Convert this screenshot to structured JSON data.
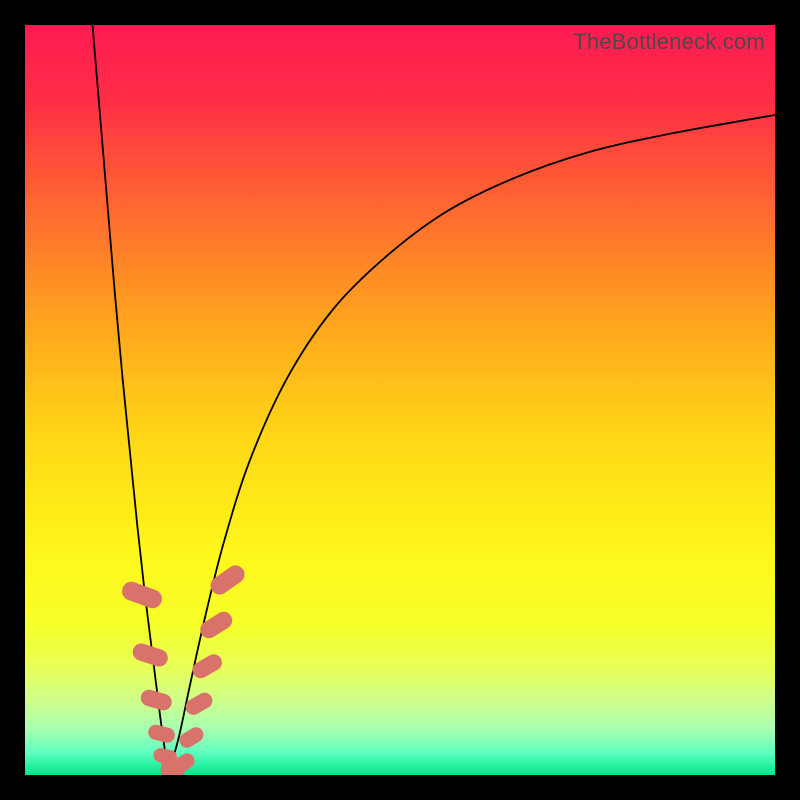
{
  "watermark": "TheBottleneck.com",
  "colors": {
    "frame": "#000000",
    "gradient_stops": [
      {
        "offset": 0.0,
        "color": "#ff1a52"
      },
      {
        "offset": 0.1,
        "color": "#ff2e46"
      },
      {
        "offset": 0.25,
        "color": "#ff6b2f"
      },
      {
        "offset": 0.4,
        "color": "#ffa61d"
      },
      {
        "offset": 0.55,
        "color": "#ffd716"
      },
      {
        "offset": 0.7,
        "color": "#fff61a"
      },
      {
        "offset": 0.8,
        "color": "#f6ff2a"
      },
      {
        "offset": 0.86,
        "color": "#e6ff5a"
      },
      {
        "offset": 0.9,
        "color": "#cfff8a"
      },
      {
        "offset": 0.94,
        "color": "#a6ffb0"
      },
      {
        "offset": 0.97,
        "color": "#5effc0"
      },
      {
        "offset": 1.0,
        "color": "#00e88a"
      }
    ],
    "curve": "#000000",
    "beads": "#d9726a"
  },
  "chart_data": {
    "type": "line",
    "title": "",
    "xlabel": "",
    "ylabel": "",
    "xlim": [
      0,
      100
    ],
    "ylim": [
      0,
      100
    ],
    "note": "Two monotone branches forming a cusp near x≈19, y=0. Values read from pixel positions; y=100 at top, y=0 at bottom.",
    "series": [
      {
        "name": "left-branch",
        "x": [
          9.0,
          10.0,
          11.0,
          12.0,
          13.0,
          14.0,
          15.0,
          16.0,
          17.0,
          18.0,
          18.7,
          19.2
        ],
        "y": [
          100,
          88,
          76,
          64,
          53,
          43,
          33,
          24,
          16,
          8,
          3,
          0.5
        ]
      },
      {
        "name": "right-branch",
        "x": [
          19.2,
          20.5,
          22.0,
          24.0,
          26.5,
          30.0,
          35.0,
          41.0,
          48.0,
          56.0,
          65.0,
          75.0,
          86.0,
          100.0
        ],
        "y": [
          0.5,
          5,
          12,
          21,
          31,
          42,
          53,
          62,
          69,
          75,
          79.5,
          83,
          85.5,
          88
        ]
      }
    ],
    "markers": {
      "name": "beads",
      "shape": "rounded-rect",
      "points": [
        {
          "x": 15.6,
          "y": 24.0,
          "w": 2.5,
          "h": 5.5,
          "r": -70
        },
        {
          "x": 16.7,
          "y": 16.0,
          "w": 2.3,
          "h": 4.8,
          "r": -72
        },
        {
          "x": 17.5,
          "y": 10.0,
          "w": 2.2,
          "h": 4.2,
          "r": -74
        },
        {
          "x": 18.2,
          "y": 5.5,
          "w": 2.0,
          "h": 3.6,
          "r": -76
        },
        {
          "x": 18.7,
          "y": 2.5,
          "w": 1.9,
          "h": 3.2,
          "r": -78
        },
        {
          "x": 19.2,
          "y": 0.8,
          "w": 2.2,
          "h": 2.6,
          "r": 0
        },
        {
          "x": 20.2,
          "y": 1.0,
          "w": 2.4,
          "h": 2.6,
          "r": 0
        },
        {
          "x": 21.2,
          "y": 1.6,
          "w": 2.0,
          "h": 3.0,
          "r": 55
        },
        {
          "x": 22.2,
          "y": 5.0,
          "w": 2.0,
          "h": 3.4,
          "r": 58
        },
        {
          "x": 23.2,
          "y": 9.5,
          "w": 2.1,
          "h": 3.8,
          "r": 60
        },
        {
          "x": 24.3,
          "y": 14.5,
          "w": 2.2,
          "h": 4.2,
          "r": 60
        },
        {
          "x": 25.5,
          "y": 20.0,
          "w": 2.3,
          "h": 4.6,
          "r": 58
        },
        {
          "x": 27.0,
          "y": 26.0,
          "w": 2.4,
          "h": 5.0,
          "r": 55
        }
      ]
    }
  }
}
